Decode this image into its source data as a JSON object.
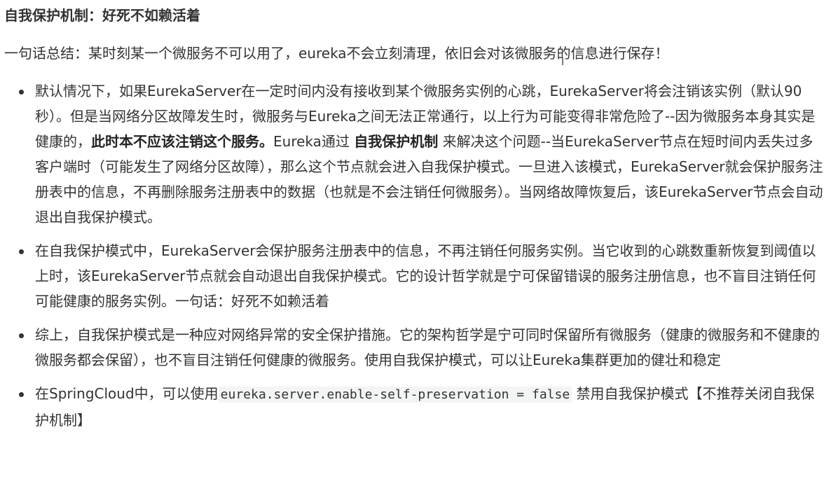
{
  "heading": "自我保护机制：好死不如赖活着",
  "summary": "一句话总结：某时刻某一个微服务不可以用了，eureka不会立刻清理，依旧会对该微服务的信息进行保存！",
  "bullets": [
    {
      "p1": "默认情况下，如果EurekaServer在一定时间内没有接收到某个微服务实例的心跳，EurekaServer将会注销该实例（默认90秒）。但是当网络分区故障发生时，微服务与Eureka之间无法正常通行，以上行为可能变得非常危险了--因为微服务本身其实是健康的，",
      "b1": "此时本不应该注销这个服务。",
      "p2": "Eureka通过 ",
      "b2": "自我保护机制",
      "p3": " 来解决这个问题--当EurekaServer节点在短时间内丢失过多客户端时（可能发生了网络分区故障），那么这个节点就会进入自我保护模式。一旦进入该模式，EurekaServer就会保护服务注册表中的信息，不再删除服务注册表中的数据（也就是不会注销任何微服务）。当网络故障恢复后，该EurekaServer节点会自动退出自我保护模式。"
    },
    {
      "text": "在自我保护模式中，EurekaServer会保护服务注册表中的信息，不再注销任何服务实例。当它收到的心跳数重新恢复到阈值以上时，该EurekaServer节点就会自动退出自我保护模式。它的设计哲学就是宁可保留错误的服务注册信息，也不盲目注销任何可能健康的服务实例。一句话：好死不如赖活着"
    },
    {
      "text": "综上，自我保护模式是一种应对网络异常的安全保护措施。它的架构哲学是宁可同时保留所有微服务（健康的微服务和不健康的微服务都会保留），也不盲目注销任何健康的微服务。使用自我保护模式，可以让Eureka集群更加的健壮和稳定"
    },
    {
      "before": "在SpringCloud中，可以使用",
      "code": "eureka.server.enable-self-preservation = false",
      "after": " 禁用自我保护模式【不推荐关闭自我保护机制】"
    }
  ],
  "colors": {
    "text": "#333333",
    "code_background": "#f3f4f4"
  },
  "icons": {
    "cursor": "text-cursor-icon"
  }
}
